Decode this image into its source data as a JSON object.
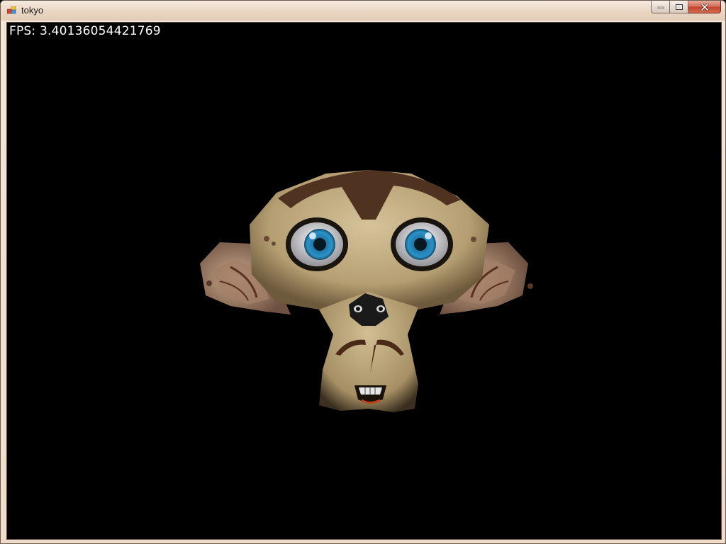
{
  "window": {
    "title": "tokyo",
    "icon": "app-icon"
  },
  "caption_buttons": {
    "minimize": "minimize-icon",
    "maximize": "maximize-icon",
    "close": "close-icon"
  },
  "viewport": {
    "fps_text": "FPS: 3.40136054421769",
    "background": "#000000"
  },
  "colors": {
    "skin": "#c9b48a",
    "fur": "#5a3a24",
    "iris": "#1f7fb0"
  }
}
